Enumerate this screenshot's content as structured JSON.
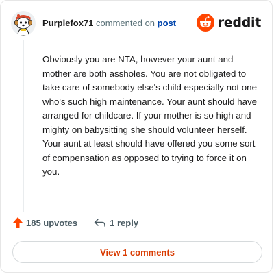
{
  "comment": {
    "username": "Purplefox71",
    "action_text": "commented on",
    "post_link": "post",
    "body": "Obviously you are NTA, however your aunt and mother are both assholes. You are not obligated to take care of somebody else's child especially not one who's such high maintenance. Your aunt should have arranged for childcare. If your mother is so high and mighty on babysitting she should volunteer herself. Your aunt at least should have offered you some sort of compensation as opposed to trying to force it on you."
  },
  "brand": {
    "wordmark": "reddit",
    "icon": "reddit-logo-icon",
    "color": "#ff4500"
  },
  "actions": {
    "upvotes_label": "185 upvotes",
    "reply_label": "1 reply",
    "upvote_icon": "upvote-arrow-icon",
    "reply_icon": "reply-arrow-icon"
  },
  "footer": {
    "view_comments_label": "View 1 comments"
  },
  "colors": {
    "accent": "#d93a00",
    "upvote": "#ff4500",
    "link": "#0045ac"
  }
}
